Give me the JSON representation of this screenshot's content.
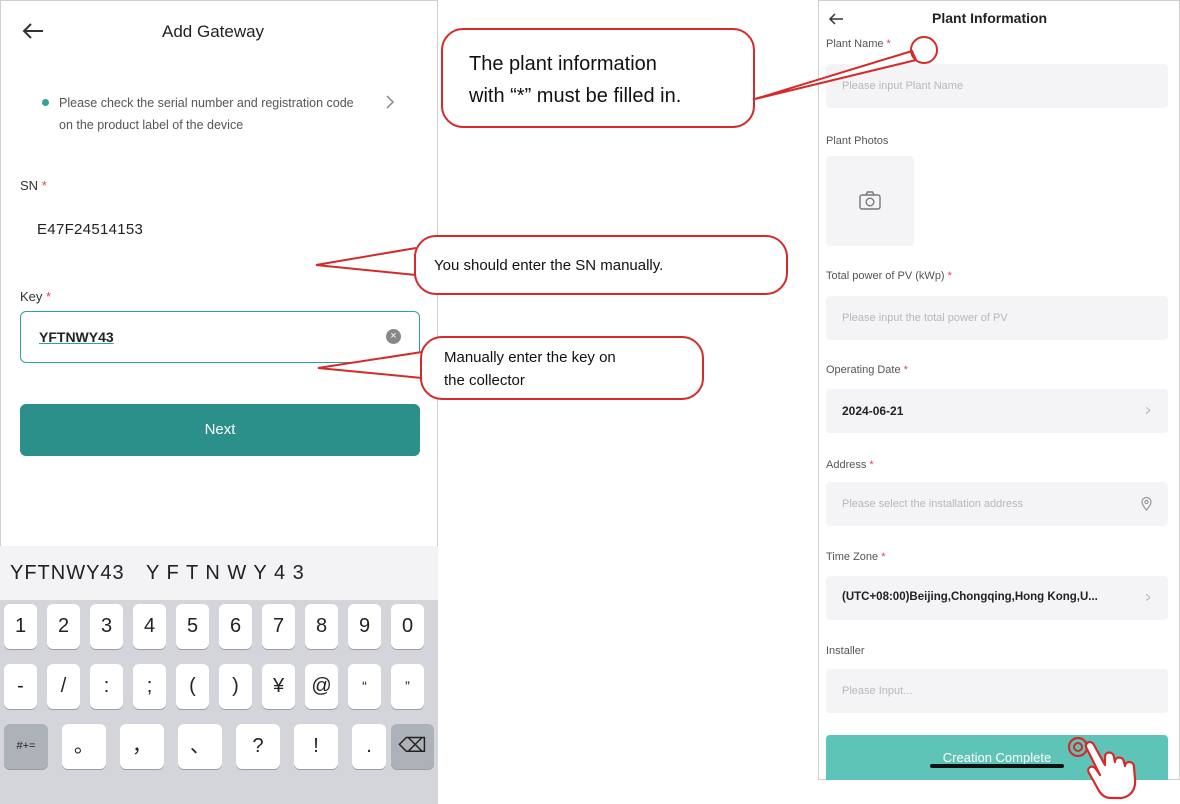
{
  "left_screen": {
    "title": "Add Gateway",
    "hint": "Please check the serial number and registration code on the product label of the device",
    "sn_label": "SN",
    "sn_value": "E47F24514153",
    "key_label": "Key",
    "key_value": "YFTNWY43",
    "next_button": "Next",
    "required_mark": "*",
    "keyboard": {
      "suggestion_1": "YFTNWY43",
      "suggestion_2": "Y F T N W Y 4 3",
      "row1": [
        "1",
        "2",
        "3",
        "4",
        "5",
        "6",
        "7",
        "8",
        "9",
        "0"
      ],
      "row2": [
        "-",
        "/",
        ":",
        ";",
        "(",
        ")",
        "¥",
        "@",
        "“",
        "”"
      ],
      "row3": [
        "#+=",
        "。",
        "，",
        "、",
        "?",
        "!",
        "."
      ],
      "backspace": "⌫"
    }
  },
  "right_screen": {
    "title": "Plant Information",
    "plant_name_label": "Plant Name",
    "plant_name_placeholder": "Please input Plant Name",
    "plant_photos_label": "Plant Photos",
    "total_power_label": "Total power of PV (kWp)",
    "total_power_placeholder": "Please input the total power of PV",
    "operating_date_label": "Operating Date",
    "operating_date_value": "2024-06-21",
    "address_label": "Address",
    "address_placeholder": "Please select the installation address",
    "time_zone_label": "Time Zone",
    "time_zone_value": "(UTC+08:00)Beijing,Chongqing,Hong Kong,U...",
    "installer_label": "Installer",
    "installer_placeholder": "Please Input...",
    "create_button": "Creation Complete",
    "required_mark": "*"
  },
  "callouts": {
    "plant_info_line1": "The plant information",
    "plant_info_line2": "with “*” must be filled in.",
    "sn": "You should enter the SN manually.",
    "key_line1": "Manually enter the key on",
    "key_line2": "the collector"
  },
  "colors": {
    "teal": "#2c908a",
    "light_teal": "#5fc4b8",
    "callout_red": "#d42a2a",
    "required_red": "#e0454b"
  },
  "icons": [
    "back-arrow-icon",
    "chevron-right-icon",
    "clear-icon",
    "camera-icon",
    "location-icon",
    "backspace-icon",
    "hand-pointer-icon"
  ]
}
